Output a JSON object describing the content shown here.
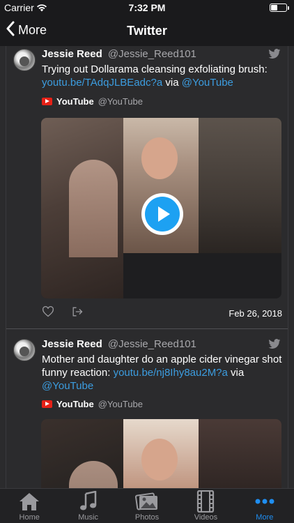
{
  "status": {
    "carrier": "Carrier",
    "time": "7:32 PM"
  },
  "nav": {
    "back_label": "More",
    "title": "Twitter"
  },
  "tweets": [
    {
      "name": "Jessie Reed",
      "handle": "@Jessie_Reed101",
      "text_plain": "Trying out Dollarama cleansing exfoliating brush:",
      "link": "youtu.be/TAdqJLBEadc?a",
      "via": "via",
      "mention": "@YouTube",
      "card_name": "YouTube",
      "card_handle": "@YouTube",
      "date": "Feb 26, 2018"
    },
    {
      "name": "Jessie Reed",
      "handle": "@Jessie_Reed101",
      "text_plain": "Mother and daughter do an apple cider vinegar shot funny reaction:",
      "link": "youtu.be/nj8Ihy8au2M?a",
      "via": "via",
      "mention": "@YouTube",
      "card_name": "YouTube",
      "card_handle": "@YouTube"
    }
  ],
  "tabs": [
    {
      "label": "Home",
      "icon": "home-icon"
    },
    {
      "label": "Music",
      "icon": "music-icon"
    },
    {
      "label": "Photos",
      "icon": "photos-icon"
    },
    {
      "label": "Videos",
      "icon": "videos-icon"
    },
    {
      "label": "More",
      "icon": "more-icon"
    }
  ],
  "colors": {
    "accent": "#1f8ef1",
    "link": "#3c9de0",
    "background": "#2b2b2d"
  }
}
